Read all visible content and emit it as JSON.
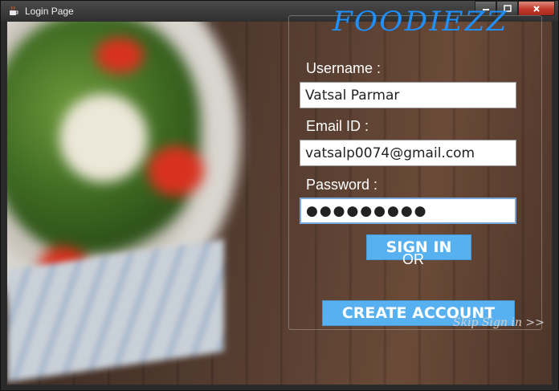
{
  "window": {
    "title": "Login Page",
    "icon": "java-cup-icon",
    "controls": [
      "minimize-icon",
      "maximize-icon",
      "close-icon"
    ]
  },
  "brand": {
    "name": "FOODIEZZ",
    "color": "#1e90ff"
  },
  "form": {
    "username_label": "Username :",
    "username_value": "Vatsal Parmar",
    "email_label": "Email ID :",
    "email_value": "vatsalp0074@gmail.com",
    "password_label": "Password :",
    "password_value": "●●●●●●●●●",
    "signin_label": "SIGN IN",
    "or_label": "OR",
    "create_label": "CREATE ACCOUNT",
    "skip_label": "Skip Sign in >>"
  },
  "colors": {
    "button_bg": "#57b1f0",
    "title_text": "#1e90ff"
  }
}
